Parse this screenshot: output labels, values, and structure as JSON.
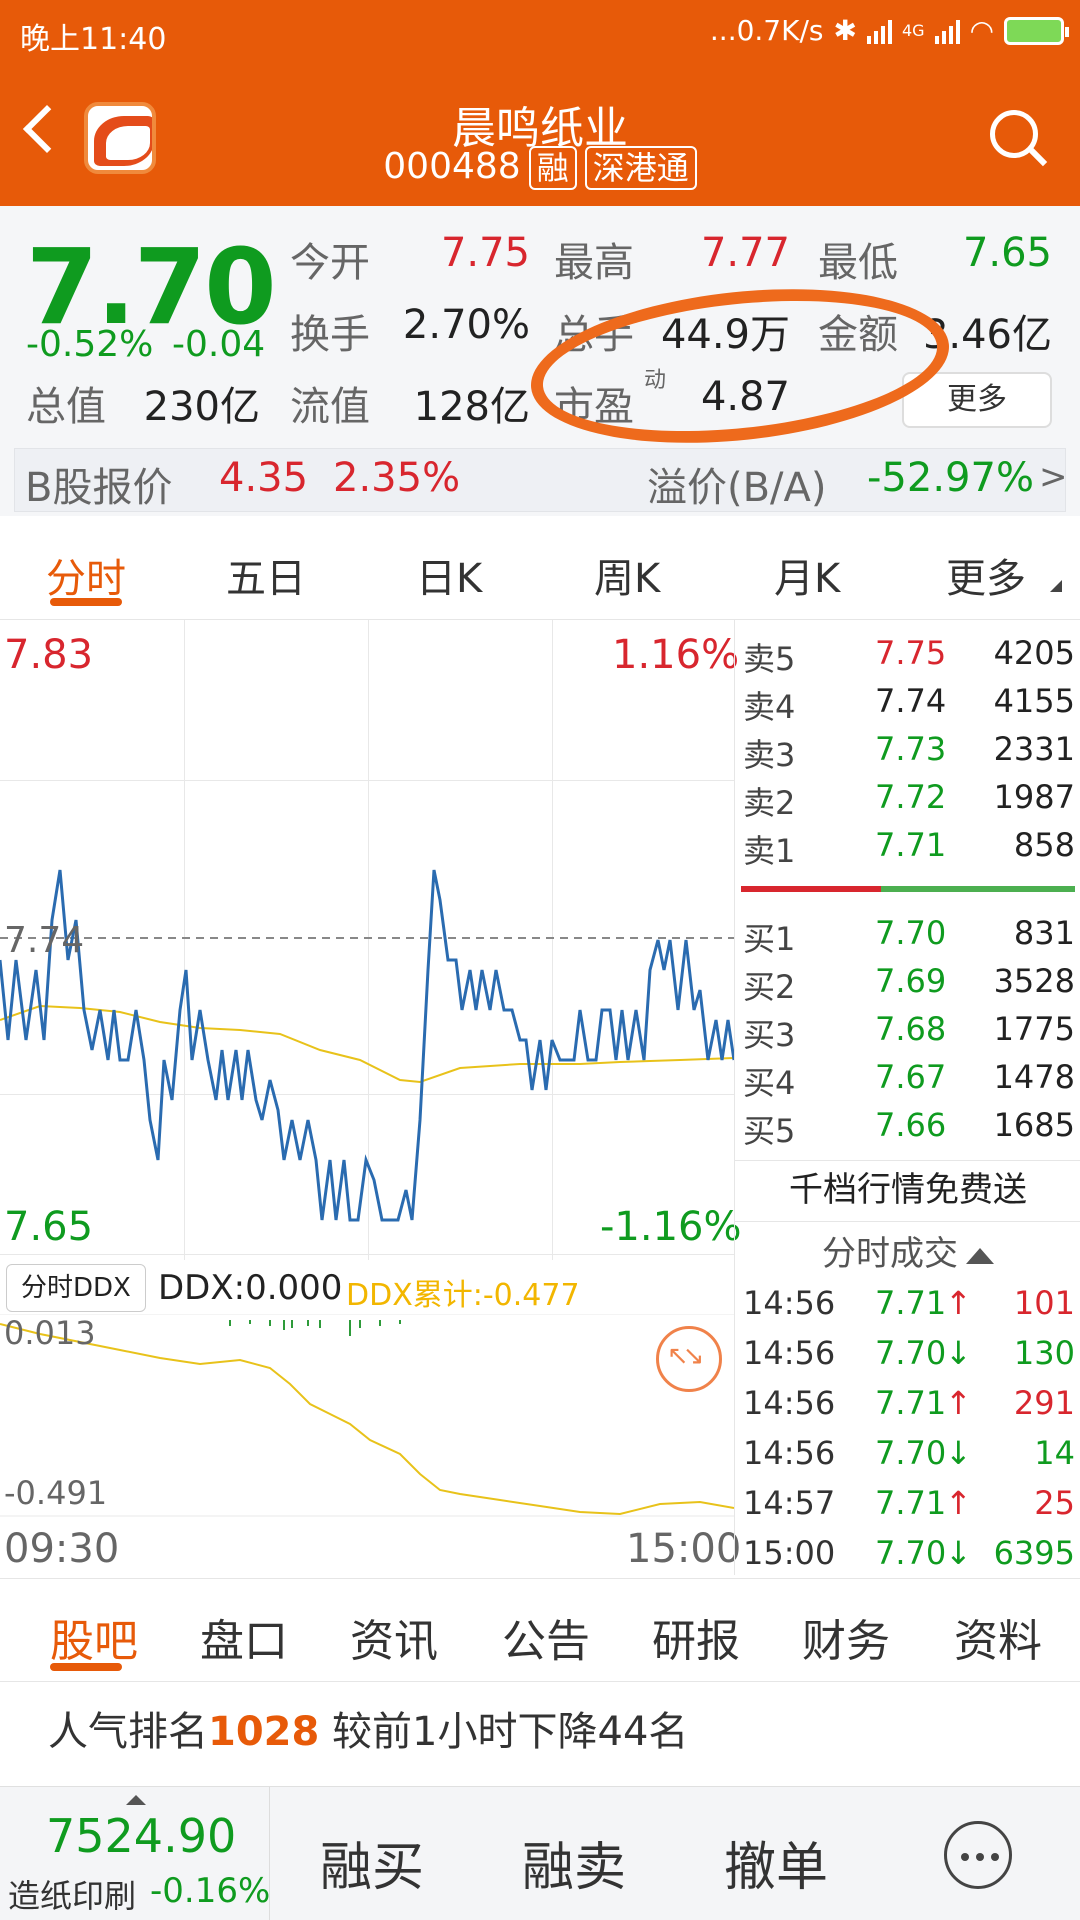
{
  "status_bar": {
    "time": "晚上11:40",
    "net_speed": "...0.7K/s",
    "network": "4G"
  },
  "header": {
    "stock_name": "晨鸣纸业",
    "stock_code": "000488",
    "tags": [
      "融",
      "深港通"
    ],
    "bg_color": "#e75a09"
  },
  "quote": {
    "price": "7.70",
    "change_pct": "-0.52%",
    "change_abs": "-0.04",
    "fields": [
      {
        "label": "今开",
        "value": "7.75",
        "color": "red"
      },
      {
        "label": "最高",
        "value": "7.77",
        "color": "red"
      },
      {
        "label": "最低",
        "value": "7.65",
        "color": "green"
      },
      {
        "label": "换手",
        "value": "2.70%",
        "color": "black"
      },
      {
        "label": "总手",
        "value": "44.9万",
        "color": "black"
      },
      {
        "label": "金额",
        "value": "3.46亿",
        "color": "black"
      },
      {
        "label": "总值",
        "value": "230亿",
        "color": "black"
      },
      {
        "label": "流值",
        "value": "128亿",
        "color": "black"
      },
      {
        "label": "市盈",
        "superscript": "动",
        "value": "4.87",
        "color": "black"
      }
    ],
    "more_label": "更多",
    "b_share": {
      "label": "B股报价",
      "price": "4.35",
      "pct": "2.35%",
      "premium_label": "溢价(B/A)",
      "premium_value": "-52.97%",
      "arrow": ">"
    }
  },
  "chart_tabs": [
    "分时",
    "五日",
    "日K",
    "周K",
    "月K",
    "更多"
  ],
  "intraday_chart": {
    "y_top": "7.83",
    "y_bottom": "7.65",
    "y_ref": "7.74",
    "pct_top": "1.16%",
    "pct_bottom": "-1.16%",
    "x_start": "09:30",
    "x_end": "15:00"
  },
  "ddx": {
    "tab_label": "分时DDX",
    "value_text": "DDX:0.000",
    "cumulative_text": "DDX累计:-0.477",
    "y_top": "0.013",
    "y_bottom": "-0.491"
  },
  "order_book": {
    "asks": [
      {
        "label": "卖5",
        "price": "7.75",
        "volume": "4205",
        "color": "red"
      },
      {
        "label": "卖4",
        "price": "7.74",
        "volume": "4155",
        "color": "black"
      },
      {
        "label": "卖3",
        "price": "7.73",
        "volume": "2331",
        "color": "green"
      },
      {
        "label": "卖2",
        "price": "7.72",
        "volume": "1987",
        "color": "green"
      },
      {
        "label": "卖1",
        "price": "7.71",
        "volume": "858",
        "color": "green"
      }
    ],
    "bids": [
      {
        "label": "买1",
        "price": "7.70",
        "volume": "831",
        "color": "green"
      },
      {
        "label": "买2",
        "price": "7.69",
        "volume": "3528",
        "color": "green"
      },
      {
        "label": "买3",
        "price": "7.68",
        "volume": "1775",
        "color": "green"
      },
      {
        "label": "买4",
        "price": "7.67",
        "volume": "1478",
        "color": "green"
      },
      {
        "label": "买5",
        "price": "7.66",
        "volume": "1685",
        "color": "green"
      }
    ],
    "promo": "千档行情免费送",
    "trades_title": "分时成交",
    "trades": [
      {
        "time": "14:56",
        "price": "7.71",
        "dir": "↑",
        "vol": "101",
        "color": "red"
      },
      {
        "time": "14:56",
        "price": "7.70",
        "dir": "↓",
        "vol": "130",
        "color": "green"
      },
      {
        "time": "14:56",
        "price": "7.71",
        "dir": "↑",
        "vol": "291",
        "color": "red"
      },
      {
        "time": "14:56",
        "price": "7.70",
        "dir": "↓",
        "vol": "14",
        "color": "green"
      },
      {
        "time": "14:57",
        "price": "7.71",
        "dir": "↑",
        "vol": "25",
        "color": "red"
      },
      {
        "time": "15:00",
        "price": "7.70",
        "dir": "↓",
        "vol": "6395",
        "color": "green"
      }
    ]
  },
  "info_tabs": [
    "股吧",
    "盘口",
    "资讯",
    "公告",
    "研报",
    "财务",
    "资料"
  ],
  "popularity": {
    "prefix": "人气排名",
    "rank": "1028",
    "suffix": "较前1小时下降44名"
  },
  "bottom_bar": {
    "index_value": "7524.90",
    "index_name": "造纸印刷",
    "index_change": "-0.16%",
    "buttons": [
      "融买",
      "融卖",
      "撤单"
    ]
  },
  "colors": {
    "up": "#d8262e",
    "down": "#0f9b1f",
    "accent": "#e75a09",
    "price_line": "#2a6bb0",
    "avg_line": "#e8c21a"
  }
}
